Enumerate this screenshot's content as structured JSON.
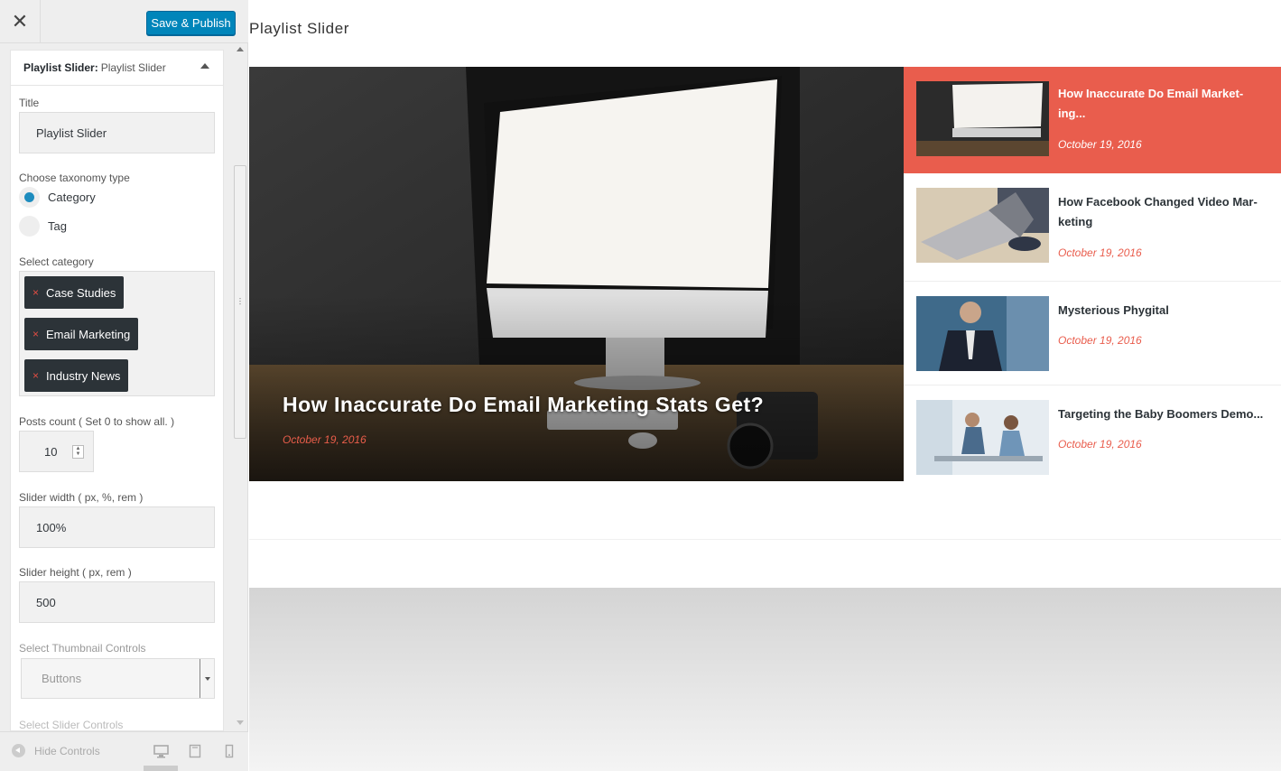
{
  "customizer": {
    "publish_label": "Save & Publish",
    "panel": {
      "type": "Playlist Slider:",
      "name": "Playlist Slider"
    },
    "title_label": "Title",
    "title_value": "Playlist Slider",
    "taxonomy_label": "Choose taxonomy type",
    "taxonomy_options": [
      "Category",
      "Tag"
    ],
    "taxonomy_selected": "Category",
    "category_label": "Select category",
    "categories": [
      "Case Studies",
      "Email Marketing",
      "Industry News"
    ],
    "chip_remove_glyph": "×",
    "posts_count_label": "Posts count ( Set 0 to show all. )",
    "posts_count_value": "10",
    "slider_width_label": "Slider width ( px, %, rem )",
    "slider_width_value": "100%",
    "slider_height_label": "Slider height ( px, rem )",
    "slider_height_value": "500",
    "thumbnail_controls_label": "Select Thumbnail Controls",
    "thumbnail_controls_value": "Buttons",
    "slider_controls_label": "Select Slider Controls",
    "hide_controls_label": "Hide Controls",
    "icons": {
      "close": "close-icon",
      "collapse": "chevron-up-icon",
      "desktop": "desktop-icon",
      "tablet": "tablet-icon",
      "mobile": "mobile-icon",
      "hide": "collapse-left-icon"
    }
  },
  "preview": {
    "widget_title": "Playlist Slider",
    "hero": {
      "title": "How Inaccurate Do Email Marketing Stats Get?",
      "date": "October 19, 2016"
    },
    "posts": [
      {
        "title_line1": "How Inaccurate Do Email Market-",
        "title_line2": "ing...",
        "date": "October 19, 2016",
        "active": true
      },
      {
        "title_line1": "How Facebook Changed Video Mar-",
        "title_line2": "keting",
        "date": "October 19, 2016",
        "active": false
      },
      {
        "title_line1": "Mysterious Phygital",
        "title_line2": "",
        "date": "October 19, 2016",
        "active": false
      },
      {
        "title_line1": "Targeting the Baby Boomers Demo...",
        "title_line2": "",
        "date": "October 19, 2016",
        "active": false
      }
    ],
    "colors": {
      "accent": "#e95d4d",
      "publish_button": "#0085ba",
      "chip_bg": "#2c3338"
    }
  }
}
